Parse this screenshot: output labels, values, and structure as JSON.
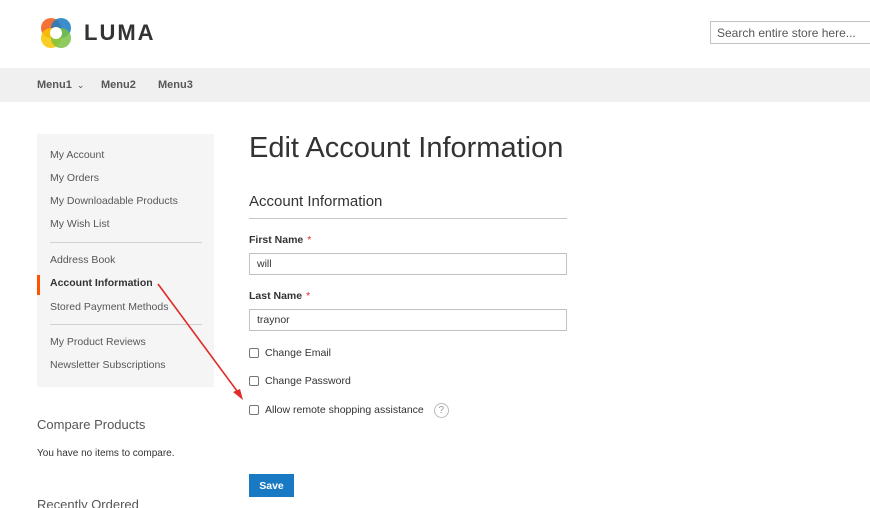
{
  "header": {
    "logo_text": "LUMA",
    "search_placeholder": "Search entire store here..."
  },
  "nav": {
    "items": [
      {
        "label": "Menu1",
        "has_dropdown": true
      },
      {
        "label": "Menu2"
      },
      {
        "label": "Menu3"
      }
    ]
  },
  "sidebar": {
    "items": [
      {
        "label": "My Account"
      },
      {
        "label": "My Orders"
      },
      {
        "label": "My Downloadable Products"
      },
      {
        "label": "My Wish List"
      },
      {
        "label": "Address Book"
      },
      {
        "label": "Account Information",
        "active": true
      },
      {
        "label": "Stored Payment Methods"
      },
      {
        "label": "My Product Reviews"
      },
      {
        "label": "Newsletter Subscriptions"
      }
    ],
    "compare_title": "Compare Products",
    "compare_empty": "You have no items to compare.",
    "recent_title": "Recently Ordered"
  },
  "main": {
    "page_title": "Edit Account Information",
    "section_title": "Account Information",
    "first_name_label": "First Name",
    "first_name_value": "will",
    "last_name_label": "Last Name",
    "last_name_value": "traynor",
    "required_mark": "*",
    "change_email_label": "Change Email",
    "change_password_label": "Change Password",
    "remote_assist_label": "Allow remote shopping assistance",
    "help_glyph": "?",
    "save_label": "Save"
  },
  "colors": {
    "accent_blue": "#1979c3",
    "active_bar": "#ff5501",
    "required": "#e02b27",
    "annotation_arrow": "#e02b27"
  },
  "icons": [
    "luma-logo-icon",
    "chevron-down-icon",
    "help-icon",
    "annotation-arrow"
  ]
}
